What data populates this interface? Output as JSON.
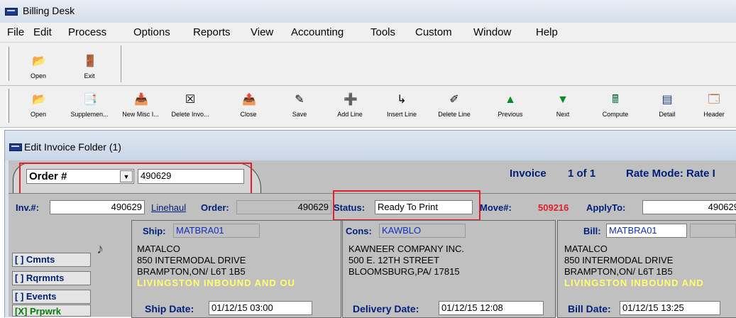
{
  "window": {
    "title": "Billing Desk"
  },
  "menu": [
    "File",
    "Edit",
    "Process",
    "Options",
    "Reports",
    "View",
    "Accounting",
    "Tools",
    "Custom",
    "Window",
    "Help"
  ],
  "toolbar1": [
    {
      "label": "Open",
      "icon": "📂"
    },
    {
      "label": "Exit",
      "icon": "🚪"
    }
  ],
  "toolbar2": [
    {
      "label": "Open",
      "icon": "📂"
    },
    {
      "label": "Supplemen...",
      "icon": "📑"
    },
    {
      "label": "New Misc I...",
      "icon": "📥"
    },
    {
      "label": "Delete Invo...",
      "icon": "☒"
    },
    {
      "label": "Close",
      "icon": "📤"
    },
    {
      "label": "Save",
      "icon": "✎"
    },
    {
      "label": "Add Line",
      "icon": "➕"
    },
    {
      "label": "Insert Line",
      "icon": "↳"
    },
    {
      "label": "Delete Line",
      "icon": "✐"
    },
    {
      "label": "Previous",
      "icon": "▲"
    },
    {
      "label": "Next",
      "icon": "▼"
    },
    {
      "label": "Compute",
      "icon": "🖩"
    },
    {
      "label": "Detail",
      "icon": "▤"
    },
    {
      "label": "Header",
      "icon": "🗔"
    }
  ],
  "child": {
    "title": "Edit Invoice Folder (1)"
  },
  "search": {
    "type": "Order #",
    "value": "490629"
  },
  "invoice_nav": {
    "label": "Invoice",
    "position": "1 of 1"
  },
  "rate_mode": "Rate Mode: Rate I",
  "header": {
    "inv_label": "Inv.#:",
    "inv_value": "490629",
    "linehaul": "Linehaul",
    "order_label": "Order:",
    "order_value": "490629",
    "status_label": "Status:",
    "status_value": "Ready To Print",
    "move_label": "Move#:",
    "move_value": "509216",
    "applyto_label": "ApplyTo:",
    "applyto_value": "490629"
  },
  "side_buttons": [
    "[ ] Cmnts",
    "[ ] Rqrmnts",
    "[ ] Events",
    "[X] Prpwrk"
  ],
  "ship": {
    "label": "Ship:",
    "code": "MATBRA01",
    "lines": [
      "MATALCO",
      "850 INTERMODAL DRIVE",
      "BRAMPTON,ON/ L6T 1B5"
    ],
    "note": "LIVINGSTON INBOUND AND OU",
    "date_label": "Ship Date:",
    "date_value": "01/12/15 03:00"
  },
  "cons": {
    "label": "Cons:",
    "code": "KAWBLO",
    "lines": [
      "KAWNEER COMPANY INC.",
      "500 E. 12TH STREET",
      "BLOOMSBURG,PA/ 17815"
    ],
    "date_label": "Delivery Date:",
    "date_value": "01/12/15 12:08"
  },
  "bill": {
    "label": "Bill:",
    "code": "MATBRA01",
    "lines": [
      "MATALCO",
      "850 INTERMODAL DRIVE",
      "BRAMPTON,ON/ L6T 1B5"
    ],
    "note": "LIVINGSTON INBOUND AND",
    "date_label": "Bill Date:",
    "date_value": "01/12/15 13:25"
  },
  "colors": {
    "highlight": "#e0202a",
    "move_number": "#e0202a",
    "note_yellow": "#ffff66",
    "label_navy": "#001f7a"
  }
}
